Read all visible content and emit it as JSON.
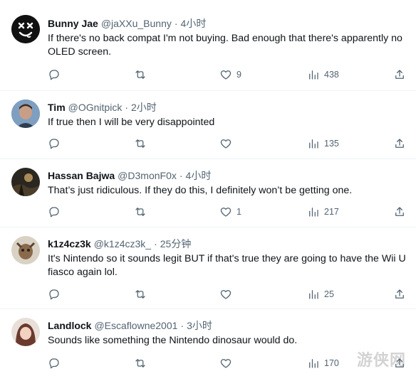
{
  "tweets": [
    {
      "name": "Bunny Jae",
      "handle": "@jaXXu_Bunny",
      "dot": "·",
      "time": "4小时",
      "text": "If there's no back compat I'm not buying. Bad enough that there's apparently no OLED screen.",
      "stats": {
        "replies": "",
        "retweets": "",
        "likes": "9",
        "views": "438"
      }
    },
    {
      "name": "Tim",
      "handle": "@OGnitpick",
      "dot": "·",
      "time": "2小时",
      "text": "If true then I will be very disappointed",
      "stats": {
        "replies": "",
        "retweets": "",
        "likes": "",
        "views": "135"
      }
    },
    {
      "name": "Hassan Bajwa",
      "handle": "@D3monF0x",
      "dot": "·",
      "time": "4小时",
      "text": "That’s just ridiculous. If they do this, I definitely won’t be getting one.",
      "stats": {
        "replies": "",
        "retweets": "",
        "likes": "1",
        "views": "217"
      }
    },
    {
      "name": "k1z4cz3k",
      "handle": "@k1z4cz3k_",
      "dot": "·",
      "time": "25分钟",
      "text": "It's Nintendo so it sounds legit BUT if that's true they are going to have the Wii U fiasco again lol.",
      "stats": {
        "replies": "",
        "retweets": "",
        "likes": "",
        "views": "25"
      }
    },
    {
      "name": "Landlock",
      "handle": "@Escaflowne2001",
      "dot": "·",
      "time": "3小时",
      "text": "Sounds like something the Nintendo dinosaur would do.",
      "stats": {
        "replies": "",
        "retweets": "",
        "likes": "",
        "views": "170"
      }
    }
  ],
  "icons": {
    "reply": "reply-icon",
    "retweet": "retweet-icon",
    "like": "heart-icon",
    "views": "views-icon",
    "share": "share-icon"
  },
  "watermark": "游侠网",
  "colors": {
    "text": "#0f1419",
    "secondary": "#536471",
    "divider": "#eff3f4"
  }
}
